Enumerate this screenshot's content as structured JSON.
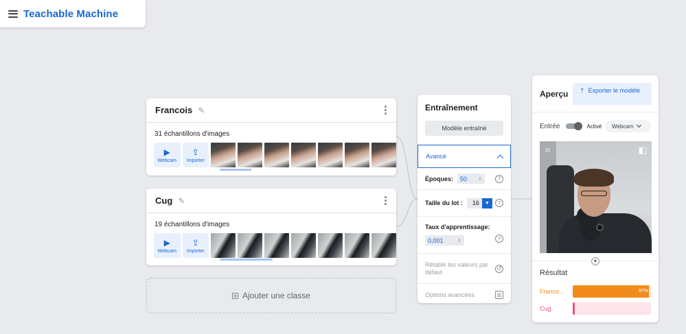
{
  "header": {
    "app_title": "Teachable Machine"
  },
  "classes": [
    {
      "name": "Francois",
      "sample_count": "31 échantillons d'images",
      "webcam_label": "Webcam",
      "upload_label": "Importer",
      "thumb_kind": "face",
      "thumb_count": 7
    },
    {
      "name": "Cug",
      "sample_count": "19 échantillons d'images",
      "webcam_label": "Webcam",
      "upload_label": "Importer",
      "thumb_kind": "obj",
      "thumb_count": 7
    }
  ],
  "add_class": {
    "label": "Ajouter une classe"
  },
  "training": {
    "title": "Entraînement",
    "train_button": "Modèle entraîné",
    "advanced_label": "Avancé",
    "epochs_label": "Époques:",
    "epochs_value": "50",
    "batch_label": "Taille du lot :",
    "batch_value": "16",
    "lr_label": "Taux d'apprentissage:",
    "lr_value": "0,001",
    "reset_label": "Rétablir les valeurs par défaut",
    "advanced_options_label": "Options avancées"
  },
  "preview": {
    "title": "Aperçu",
    "export_button": "Exporter le modèle",
    "input_label": "Entrée",
    "toggle_label": "Activé",
    "source_value": "Webcam",
    "result_title": "Résultat",
    "results": [
      {
        "label": "Franco...",
        "percent_text": "97%",
        "value": 0.97,
        "color": "#f28b1b",
        "track": "#fde7cf"
      },
      {
        "label": "Cug",
        "percent_text": "",
        "value": 0.03,
        "color": "#e8557a",
        "track": "#fde4ea"
      }
    ]
  },
  "colors": {
    "accent": "#1967d2",
    "background": "#e8eaed"
  }
}
